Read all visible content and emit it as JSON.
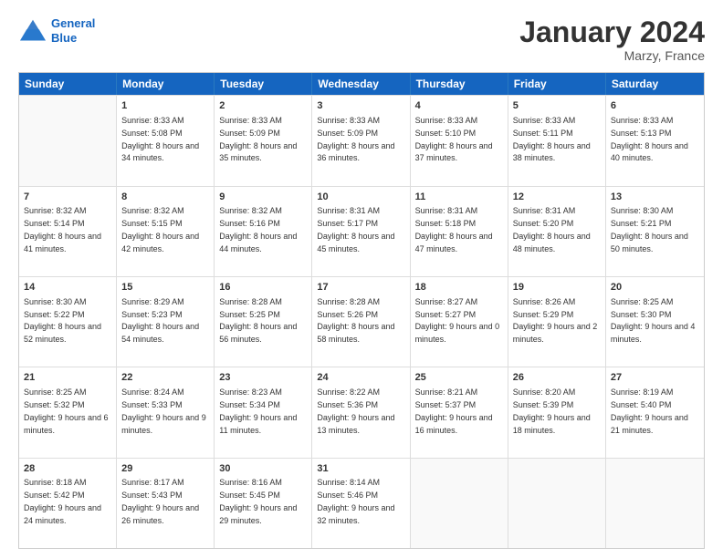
{
  "logo": {
    "line1": "General",
    "line2": "Blue"
  },
  "title": "January 2024",
  "subtitle": "Marzy, France",
  "days": [
    "Sunday",
    "Monday",
    "Tuesday",
    "Wednesday",
    "Thursday",
    "Friday",
    "Saturday"
  ],
  "weeks": [
    [
      {
        "num": "",
        "sunrise": "",
        "sunset": "",
        "daylight": ""
      },
      {
        "num": "1",
        "sunrise": "Sunrise: 8:33 AM",
        "sunset": "Sunset: 5:08 PM",
        "daylight": "Daylight: 8 hours and 34 minutes."
      },
      {
        "num": "2",
        "sunrise": "Sunrise: 8:33 AM",
        "sunset": "Sunset: 5:09 PM",
        "daylight": "Daylight: 8 hours and 35 minutes."
      },
      {
        "num": "3",
        "sunrise": "Sunrise: 8:33 AM",
        "sunset": "Sunset: 5:09 PM",
        "daylight": "Daylight: 8 hours and 36 minutes."
      },
      {
        "num": "4",
        "sunrise": "Sunrise: 8:33 AM",
        "sunset": "Sunset: 5:10 PM",
        "daylight": "Daylight: 8 hours and 37 minutes."
      },
      {
        "num": "5",
        "sunrise": "Sunrise: 8:33 AM",
        "sunset": "Sunset: 5:11 PM",
        "daylight": "Daylight: 8 hours and 38 minutes."
      },
      {
        "num": "6",
        "sunrise": "Sunrise: 8:33 AM",
        "sunset": "Sunset: 5:13 PM",
        "daylight": "Daylight: 8 hours and 40 minutes."
      }
    ],
    [
      {
        "num": "7",
        "sunrise": "Sunrise: 8:32 AM",
        "sunset": "Sunset: 5:14 PM",
        "daylight": "Daylight: 8 hours and 41 minutes."
      },
      {
        "num": "8",
        "sunrise": "Sunrise: 8:32 AM",
        "sunset": "Sunset: 5:15 PM",
        "daylight": "Daylight: 8 hours and 42 minutes."
      },
      {
        "num": "9",
        "sunrise": "Sunrise: 8:32 AM",
        "sunset": "Sunset: 5:16 PM",
        "daylight": "Daylight: 8 hours and 44 minutes."
      },
      {
        "num": "10",
        "sunrise": "Sunrise: 8:31 AM",
        "sunset": "Sunset: 5:17 PM",
        "daylight": "Daylight: 8 hours and 45 minutes."
      },
      {
        "num": "11",
        "sunrise": "Sunrise: 8:31 AM",
        "sunset": "Sunset: 5:18 PM",
        "daylight": "Daylight: 8 hours and 47 minutes."
      },
      {
        "num": "12",
        "sunrise": "Sunrise: 8:31 AM",
        "sunset": "Sunset: 5:20 PM",
        "daylight": "Daylight: 8 hours and 48 minutes."
      },
      {
        "num": "13",
        "sunrise": "Sunrise: 8:30 AM",
        "sunset": "Sunset: 5:21 PM",
        "daylight": "Daylight: 8 hours and 50 minutes."
      }
    ],
    [
      {
        "num": "14",
        "sunrise": "Sunrise: 8:30 AM",
        "sunset": "Sunset: 5:22 PM",
        "daylight": "Daylight: 8 hours and 52 minutes."
      },
      {
        "num": "15",
        "sunrise": "Sunrise: 8:29 AM",
        "sunset": "Sunset: 5:23 PM",
        "daylight": "Daylight: 8 hours and 54 minutes."
      },
      {
        "num": "16",
        "sunrise": "Sunrise: 8:28 AM",
        "sunset": "Sunset: 5:25 PM",
        "daylight": "Daylight: 8 hours and 56 minutes."
      },
      {
        "num": "17",
        "sunrise": "Sunrise: 8:28 AM",
        "sunset": "Sunset: 5:26 PM",
        "daylight": "Daylight: 8 hours and 58 minutes."
      },
      {
        "num": "18",
        "sunrise": "Sunrise: 8:27 AM",
        "sunset": "Sunset: 5:27 PM",
        "daylight": "Daylight: 9 hours and 0 minutes."
      },
      {
        "num": "19",
        "sunrise": "Sunrise: 8:26 AM",
        "sunset": "Sunset: 5:29 PM",
        "daylight": "Daylight: 9 hours and 2 minutes."
      },
      {
        "num": "20",
        "sunrise": "Sunrise: 8:25 AM",
        "sunset": "Sunset: 5:30 PM",
        "daylight": "Daylight: 9 hours and 4 minutes."
      }
    ],
    [
      {
        "num": "21",
        "sunrise": "Sunrise: 8:25 AM",
        "sunset": "Sunset: 5:32 PM",
        "daylight": "Daylight: 9 hours and 6 minutes."
      },
      {
        "num": "22",
        "sunrise": "Sunrise: 8:24 AM",
        "sunset": "Sunset: 5:33 PM",
        "daylight": "Daylight: 9 hours and 9 minutes."
      },
      {
        "num": "23",
        "sunrise": "Sunrise: 8:23 AM",
        "sunset": "Sunset: 5:34 PM",
        "daylight": "Daylight: 9 hours and 11 minutes."
      },
      {
        "num": "24",
        "sunrise": "Sunrise: 8:22 AM",
        "sunset": "Sunset: 5:36 PM",
        "daylight": "Daylight: 9 hours and 13 minutes."
      },
      {
        "num": "25",
        "sunrise": "Sunrise: 8:21 AM",
        "sunset": "Sunset: 5:37 PM",
        "daylight": "Daylight: 9 hours and 16 minutes."
      },
      {
        "num": "26",
        "sunrise": "Sunrise: 8:20 AM",
        "sunset": "Sunset: 5:39 PM",
        "daylight": "Daylight: 9 hours and 18 minutes."
      },
      {
        "num": "27",
        "sunrise": "Sunrise: 8:19 AM",
        "sunset": "Sunset: 5:40 PM",
        "daylight": "Daylight: 9 hours and 21 minutes."
      }
    ],
    [
      {
        "num": "28",
        "sunrise": "Sunrise: 8:18 AM",
        "sunset": "Sunset: 5:42 PM",
        "daylight": "Daylight: 9 hours and 24 minutes."
      },
      {
        "num": "29",
        "sunrise": "Sunrise: 8:17 AM",
        "sunset": "Sunset: 5:43 PM",
        "daylight": "Daylight: 9 hours and 26 minutes."
      },
      {
        "num": "30",
        "sunrise": "Sunrise: 8:16 AM",
        "sunset": "Sunset: 5:45 PM",
        "daylight": "Daylight: 9 hours and 29 minutes."
      },
      {
        "num": "31",
        "sunrise": "Sunrise: 8:14 AM",
        "sunset": "Sunset: 5:46 PM",
        "daylight": "Daylight: 9 hours and 32 minutes."
      },
      {
        "num": "",
        "sunrise": "",
        "sunset": "",
        "daylight": ""
      },
      {
        "num": "",
        "sunrise": "",
        "sunset": "",
        "daylight": ""
      },
      {
        "num": "",
        "sunrise": "",
        "sunset": "",
        "daylight": ""
      }
    ]
  ]
}
